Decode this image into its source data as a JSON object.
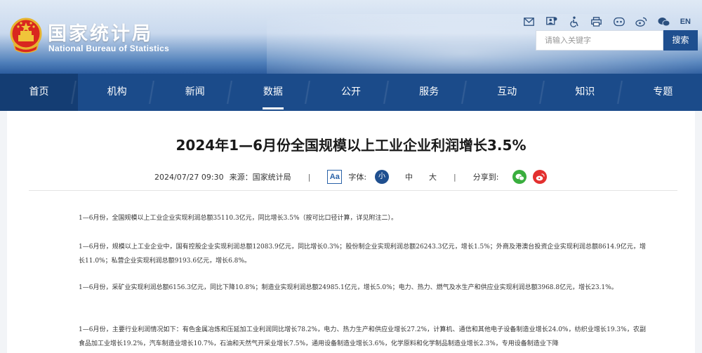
{
  "header": {
    "site_name_cn": "国家统计局",
    "site_name_en": "National Bureau of Statistics",
    "lang_label": "EN",
    "search_placeholder": "请输入关键字",
    "search_button": "搜索",
    "tool_icons": [
      "mail-icon",
      "user-icon",
      "accessibility-icon",
      "print-icon",
      "app-icon",
      "weibo-icon",
      "wechat-icon"
    ]
  },
  "nav": {
    "items": [
      "首页",
      "机构",
      "新闻",
      "数据",
      "公开",
      "服务",
      "互动",
      "知识",
      "专题"
    ],
    "active": "数据"
  },
  "article": {
    "title": "2024年1—6月份全国规模以上工业企业利润增长3.5%",
    "date": "2024/07/27 09:30",
    "source": "来源：国家统计局",
    "separator": "|",
    "font_label": "字体:",
    "font_icon_text": "Aa",
    "size_small": "小",
    "size_medium": "中",
    "size_large": "大",
    "share_label": "分享到:",
    "paragraphs": [
      "1—6月份，全国规模以上工业企业实现利润总额35110.3亿元，同比增长3.5%（按可比口径计算，详见附注二）。",
      "1—6月份，规模以上工业企业中，国有控股企业实现利润总额12083.9亿元，同比增长0.3%；股份制企业实现利润总额26243.3亿元，增长1.5%；外商及港澳台投资企业实现利润总额8614.9亿元，增长11.0%；私营企业实现利润总额9193.6亿元，增长6.8%。",
      "1—6月份，采矿业实现利润总额6156.3亿元，同比下降10.8%；制造业实现利润总额24985.1亿元，增长5.0%；电力、热力、燃气及水生产和供应业实现利润总额3968.8亿元，增长23.1%。",
      "1—6月份，主要行业利润情况如下：有色金属冶炼和压延加工业利润同比增长78.2%，电力、热力生产和供应业增长27.2%，计算机、通信和其他电子设备制造业增长24.0%，纺织业增长19.3%，农副食品加工业增长19.2%，汽车制造业增长10.7%，石油和天然气开采业增长7.5%，通用设备制造业增长3.6%，化学原料和化学制品制造业增长2.3%，专用设备制造业下降"
    ]
  },
  "colors": {
    "nav_bg": "#1b4b8a",
    "search_button_bg": "#1f4f8f",
    "wechat": "#3aae3e",
    "weibo": "#e3302f"
  }
}
